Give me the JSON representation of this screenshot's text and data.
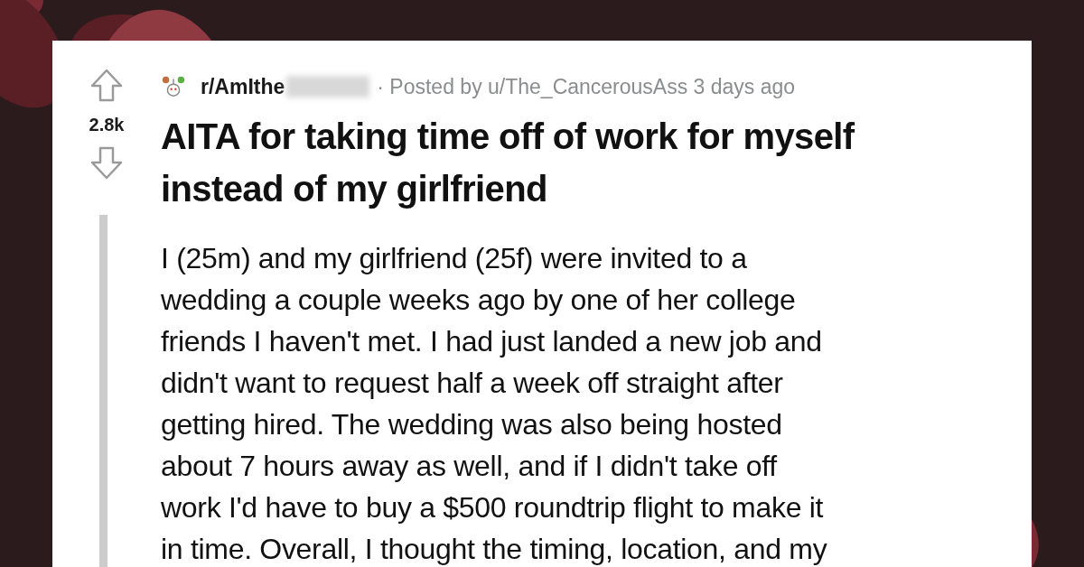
{
  "post": {
    "votes": "2.8k",
    "subreddit": "r/AmIthe",
    "subreddit_redacted": true,
    "byline": "· Posted by u/The_CancerousAss 3 days ago",
    "title": "AITA for taking time off of work for myself instead of my girlfriend",
    "body_lines": [
      "I (25m) and my girlfriend (25f) were invited to a",
      "wedding a couple weeks ago by one of her college",
      "friends I haven't met. I had just landed a new job and",
      "didn't want to request half a week off straight after",
      "getting hired. The wedding was also being hosted",
      "about 7 hours away as well, and if I didn't take off",
      "work I'd have to buy a $500 roundtrip flight to make it",
      "in time. Overall, I thought the timing, location, and my"
    ]
  }
}
